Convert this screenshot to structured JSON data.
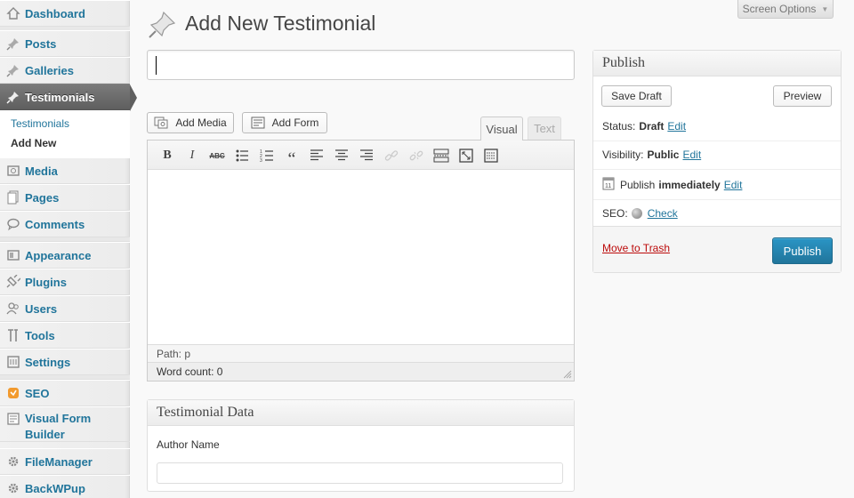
{
  "sidebar": {
    "items": [
      {
        "label": "Dashboard",
        "icon": "dashboard-icon"
      },
      {
        "label": "Posts",
        "icon": "pushpin-icon"
      },
      {
        "label": "Galleries",
        "icon": "pushpin-icon"
      },
      {
        "label": "Testimonials",
        "icon": "pushpin-icon",
        "active": true
      },
      {
        "label": "Media",
        "icon": "media-icon"
      },
      {
        "label": "Pages",
        "icon": "pages-icon"
      },
      {
        "label": "Comments",
        "icon": "comments-icon"
      },
      {
        "label": "Appearance",
        "icon": "appearance-icon"
      },
      {
        "label": "Plugins",
        "icon": "plugins-icon"
      },
      {
        "label": "Users",
        "icon": "users-icon"
      },
      {
        "label": "Tools",
        "icon": "tools-icon"
      },
      {
        "label": "Settings",
        "icon": "settings-icon"
      },
      {
        "label": "SEO",
        "icon": "seo-icon"
      },
      {
        "label": "Visual Form Builder",
        "icon": "form-icon"
      },
      {
        "label": "FileManager",
        "icon": "gear-icon"
      },
      {
        "label": "BackWPup",
        "icon": "gear-icon"
      }
    ],
    "submenu": [
      {
        "label": "Testimonials",
        "current": false
      },
      {
        "label": "Add New",
        "current": true
      }
    ]
  },
  "header": {
    "screen_options": "Screen Options",
    "page_title": "Add New Testimonial"
  },
  "title_field": {
    "value": ""
  },
  "media_buttons": {
    "add_media": "Add Media",
    "add_form": "Add Form"
  },
  "editor": {
    "tabs": {
      "visual": "Visual",
      "text": "Text"
    },
    "toolbar": [
      "bold",
      "italic",
      "strikethrough",
      "bullet-list",
      "numbered-list",
      "blockquote",
      "align-left",
      "align-center",
      "align-right",
      "insert-link",
      "remove-link",
      "insert-more",
      "fullscreen",
      "toolbar-toggle"
    ],
    "path": "Path: p",
    "word_count": "Word count: 0"
  },
  "publish": {
    "title": "Publish",
    "save_draft": "Save Draft",
    "preview": "Preview",
    "status_label": "Status:",
    "status_value": "Draft",
    "visibility_label": "Visibility:",
    "visibility_value": "Public",
    "publish_label": "Publish",
    "publish_value": "immediately",
    "seo_label": "SEO:",
    "seo_link": "Check",
    "edit": "Edit",
    "trash": "Move to Trash",
    "publish_button": "Publish"
  },
  "testimonial_data": {
    "title": "Testimonial Data",
    "author_label": "Author Name",
    "author_value": ""
  },
  "colors": {
    "link": "#21759b",
    "publish_button": "#21759b",
    "trash": "#bc0b0b",
    "active_menu": "#6d6d6d"
  }
}
